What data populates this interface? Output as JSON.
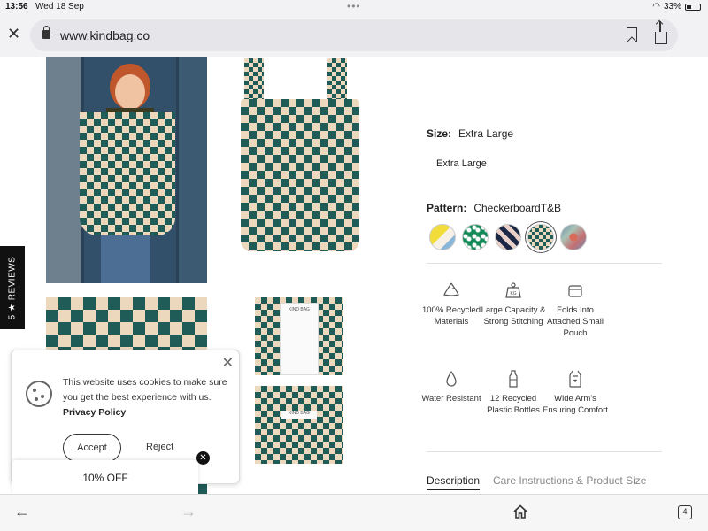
{
  "status_bar": {
    "time": "13:56",
    "date": "Wed 18 Sep",
    "battery": "33%"
  },
  "browser": {
    "url": "www.kindbag.co"
  },
  "reviews_tab": {
    "label": "5 ★ REVIEWS"
  },
  "product": {
    "size_label": "Size:",
    "size_value": "Extra Large",
    "size_option": "Extra Large",
    "pattern_label": "Pattern:",
    "pattern_value": "CheckerboardT&B"
  },
  "features": [
    {
      "icon": "recycle-icon",
      "label": "100% Recycled Materials"
    },
    {
      "icon": "weight-icon",
      "label": "Large Capacity & Strong Stitching"
    },
    {
      "icon": "pouch-icon",
      "label": "Folds Into Attached Small Pouch"
    },
    {
      "icon": "water-drop-icon",
      "label": "Water Resistant"
    },
    {
      "icon": "bottle-icon",
      "label": "12 Recycled Plastic Bottles"
    },
    {
      "icon": "bag-icon",
      "label": "Wide Arm's Ensuring Comfort"
    }
  ],
  "tabs": {
    "description": "Description",
    "care": "Care Instructions & Product Size"
  },
  "cookie": {
    "text": "This website uses cookies to make sure you get the best experience with us.",
    "policy_link": "Privacy Policy",
    "accept": "Accept",
    "reject": "Reject"
  },
  "offer": {
    "label": "10% OFF"
  },
  "toolbar": {
    "tab_count": "4"
  },
  "colors": {
    "checker_green": "#1f5b57",
    "checker_cream": "#ecd9bd"
  }
}
